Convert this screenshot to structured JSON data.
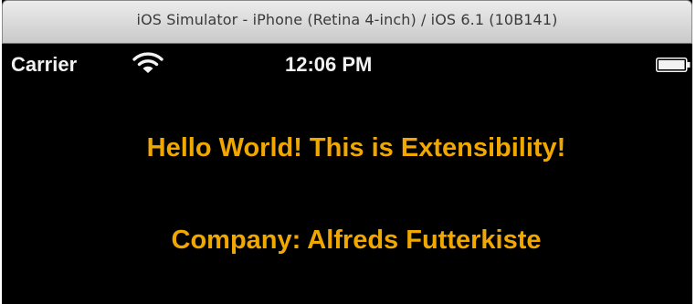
{
  "window": {
    "title": "iOS Simulator - iPhone (Retina 4-inch) / iOS 6.1 (10B141)"
  },
  "status_bar": {
    "carrier": "Carrier",
    "time": "12:06 PM",
    "wifi_icon": "wifi-icon",
    "battery_icon": "battery-full-icon"
  },
  "content": {
    "greeting": "Hello World! This is Extensibility!",
    "company": "Company: Alfreds Futterkiste"
  },
  "colors": {
    "label_text": "#f0a800",
    "background": "#000000",
    "status_text": "#ffffff"
  }
}
